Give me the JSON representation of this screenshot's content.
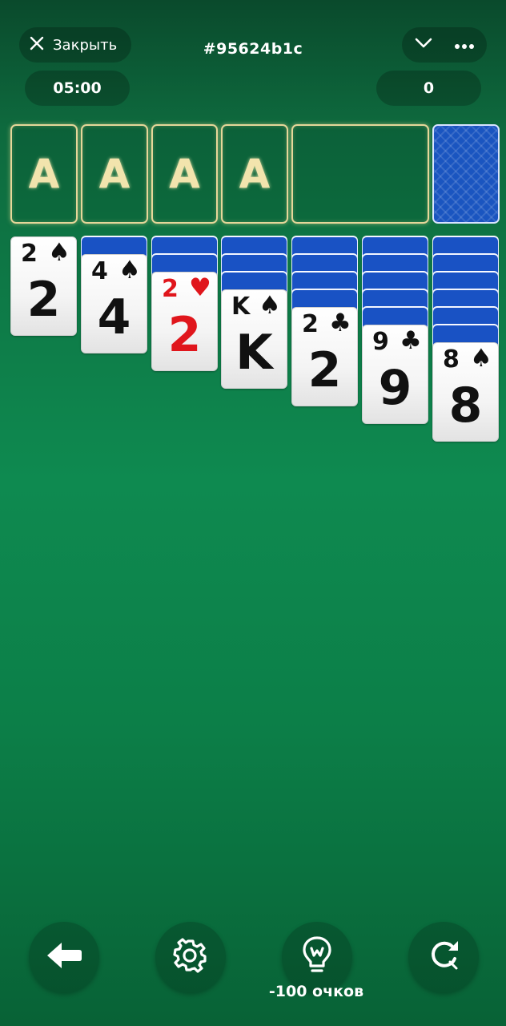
{
  "header": {
    "close_label": "Закрыть",
    "game_id": "#95624b1c",
    "timer": "05:00",
    "score": "0"
  },
  "foundations": [
    "A",
    "A",
    "A",
    "A"
  ],
  "tableau": [
    {
      "hidden": 0,
      "rank": "2",
      "suit": "♠",
      "color": "black"
    },
    {
      "hidden": 1,
      "rank": "4",
      "suit": "♠",
      "color": "black"
    },
    {
      "hidden": 2,
      "rank": "2",
      "suit": "♥",
      "color": "red"
    },
    {
      "hidden": 3,
      "rank": "K",
      "suit": "♠",
      "color": "black"
    },
    {
      "hidden": 4,
      "rank": "2",
      "suit": "♣",
      "color": "black"
    },
    {
      "hidden": 5,
      "rank": "9",
      "suit": "♣",
      "color": "black"
    },
    {
      "hidden": 6,
      "rank": "8",
      "suit": "♠",
      "color": "black"
    }
  ],
  "controls": {
    "hint_cost": "-100 очков",
    "icons": [
      "undo-icon",
      "settings-icon",
      "hint-icon",
      "restart-icon"
    ]
  },
  "colors": {
    "felt": "#0e8a50",
    "card_back": "#1952c4",
    "slot_glow": "#e6d79a",
    "red_suit": "#e0161c"
  }
}
